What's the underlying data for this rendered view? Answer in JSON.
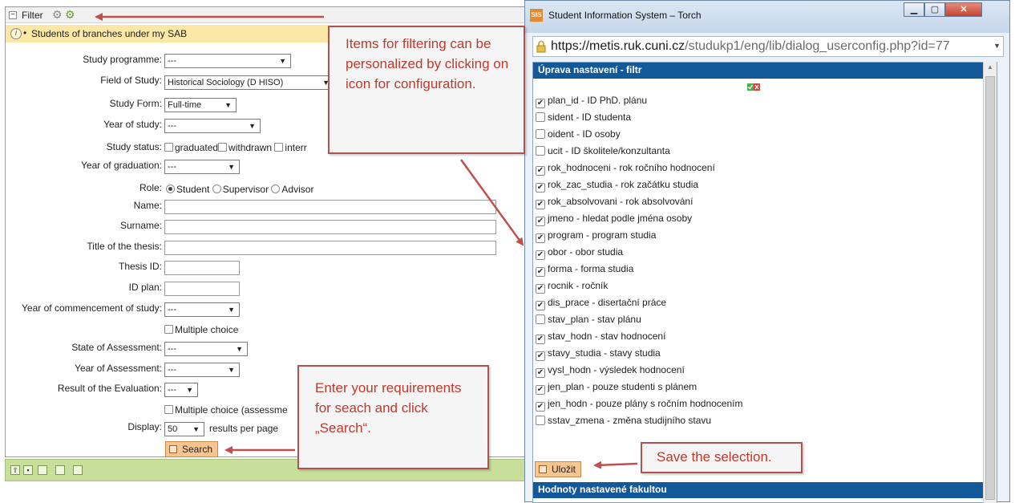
{
  "filter": {
    "title": "Filter",
    "info_text": "Students of branches under my SAB",
    "info_bullet": "•",
    "fields": {
      "study_programme": {
        "label": "Study programme:",
        "value": "---"
      },
      "field_of_study": {
        "label": "Field of Study:",
        "value": "Historical Sociology (D HISO)"
      },
      "study_form": {
        "label": "Study Form:",
        "value": "Full-time"
      },
      "year_of_study": {
        "label": "Year of study:",
        "value": "---"
      },
      "study_status": {
        "label": "Study status:",
        "options": [
          "graduated",
          "withdrawn",
          "interr"
        ]
      },
      "year_of_graduation": {
        "label": "Year of graduation:",
        "value": "---"
      },
      "role": {
        "label": "Role:",
        "options": [
          "Student",
          "Supervisor",
          "Advisor"
        ],
        "selected": "Student"
      },
      "name": {
        "label": "Name:"
      },
      "surname": {
        "label": "Surname:"
      },
      "thesis_title": {
        "label": "Title of the thesis:"
      },
      "thesis_id": {
        "label": "Thesis ID:"
      },
      "id_plan": {
        "label": "ID plan:"
      },
      "year_commencement": {
        "label": "Year of commencement of study:",
        "value": "---"
      },
      "multiple_choice_1": "Multiple choice",
      "state_of_assessment": {
        "label": "State of Assessment:",
        "value": "---"
      },
      "year_of_assessment": {
        "label": "Year of Assessment:",
        "value": "---"
      },
      "result_of_evaluation": {
        "label": "Result of the Evaluation:",
        "value": "---"
      },
      "multiple_choice_2": "Multiple choice (assessme",
      "display": {
        "label": "Display:",
        "value": "50",
        "suffix": "results per page"
      }
    },
    "search_button": "Search"
  },
  "callouts": {
    "filter_config": "Items for filtering can be personalized by clicking on icon for configuration.",
    "search": "Enter your requirements for seach and click „Search“.",
    "save": "Save the selection."
  },
  "popup": {
    "window_title": "Student Information System – Torch",
    "app_icon": "SIS",
    "url_main": "https://metis.ruk.cuni.cz",
    "url_rest": "/studukp1/eng/lib/dialog_userconfig.php?id=77",
    "section_title": "Úprava nastavení - filtr",
    "items": [
      {
        "text": "plan_id - ID PhD. plánu",
        "checked": true
      },
      {
        "text": "sident - ID studenta",
        "checked": false
      },
      {
        "text": "oident - ID osoby",
        "checked": false
      },
      {
        "text": "ucit - ID školitele/konzultanta",
        "checked": false
      },
      {
        "text": "rok_hodnoceni - rok ročního hodnocení",
        "checked": true
      },
      {
        "text": "rok_zac_studia - rok začátku studia",
        "checked": true
      },
      {
        "text": "rok_absolvovani - rok absolvování",
        "checked": true
      },
      {
        "text": "jmeno - hledat podle jména osoby",
        "checked": true
      },
      {
        "text": "program - program studia",
        "checked": true
      },
      {
        "text": "obor - obor studia",
        "checked": true
      },
      {
        "text": "forma - forma studia",
        "checked": true
      },
      {
        "text": "rocnik - ročník",
        "checked": true
      },
      {
        "text": "dis_prace - disertační práce",
        "checked": true
      },
      {
        "text": "stav_plan - stav plánu",
        "checked": false
      },
      {
        "text": "stav_hodn - stav hodnocení",
        "checked": true
      },
      {
        "text": "stavy_studia - stavy studia",
        "checked": true
      },
      {
        "text": "vysl_hodn - výsledek hodnocení",
        "checked": true
      },
      {
        "text": "jen_plan - pouze studenti s plánem",
        "checked": true
      },
      {
        "text": "jen_hodn - pouze plány s ročním hodnocením",
        "checked": true
      },
      {
        "text": "sstav_zmena - změna studijního stavu",
        "checked": false
      }
    ],
    "save_button": "Uložit",
    "faculty_section_title": "Hodnoty nastavené fakultou"
  },
  "colors": {
    "callout_text": "#c0392b",
    "callout_border": "#b45050",
    "arrow": "#c0504d",
    "blue_header": "#13599a",
    "bottom_bar": "#c7df9b",
    "info_bar": "#fbe8a6",
    "search_button": "#f6c590"
  }
}
